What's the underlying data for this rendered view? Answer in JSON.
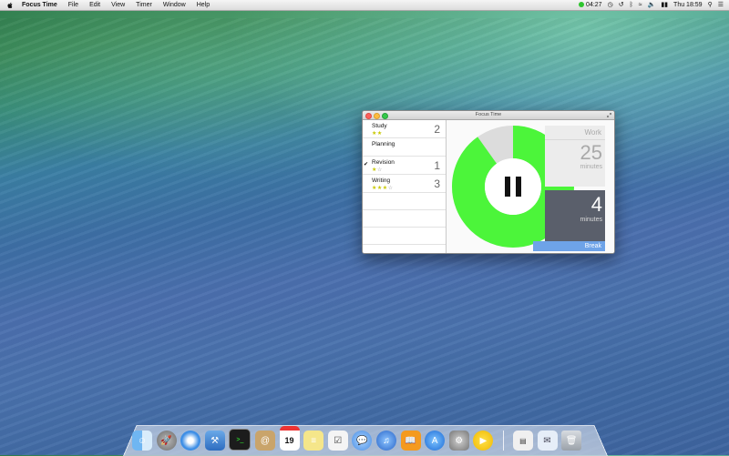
{
  "menubar": {
    "app_name": "Focus Time",
    "menus": [
      "File",
      "Edit",
      "View",
      "Timer",
      "Window",
      "Help"
    ],
    "timer_status": "04:27",
    "clock": "Thu 18:59"
  },
  "window": {
    "title": "Focus Time",
    "tasks": [
      {
        "name": "Study",
        "stars": 2,
        "max_stars": 2,
        "count": "2",
        "checked": false
      },
      {
        "name": "Planning",
        "stars": 0,
        "max_stars": 0,
        "count": "",
        "checked": false
      },
      {
        "name": "Revision",
        "stars": 1,
        "max_stars": 2,
        "count": "1",
        "checked": true
      },
      {
        "name": "Writing",
        "stars": 3,
        "max_stars": 4,
        "count": "3",
        "checked": false
      }
    ],
    "timer": {
      "work_label": "Work",
      "work_minutes": "25",
      "work_unit": "minutes",
      "break_minutes": "4",
      "break_unit": "minutes",
      "break_label": "Break",
      "progress_fraction": 0.9,
      "ring_color": "#4cf53a",
      "ring_track_color": "#dcdcdc"
    }
  },
  "dock": {
    "apps": [
      "finder",
      "launchpad",
      "safari",
      "xcode",
      "terminal",
      "contacts",
      "calendar",
      "notes",
      "reminders",
      "messages",
      "itunes",
      "ibooks",
      "app-store",
      "system-preferences",
      "focus-time"
    ],
    "calendar_day": "19",
    "documents": [
      "documents-stack",
      "downloads-stack",
      "trash"
    ]
  },
  "colors": {
    "accent_green": "#4cf53a",
    "break_blue": "#6ea3e8",
    "break_panel": "#5a5f6b"
  }
}
